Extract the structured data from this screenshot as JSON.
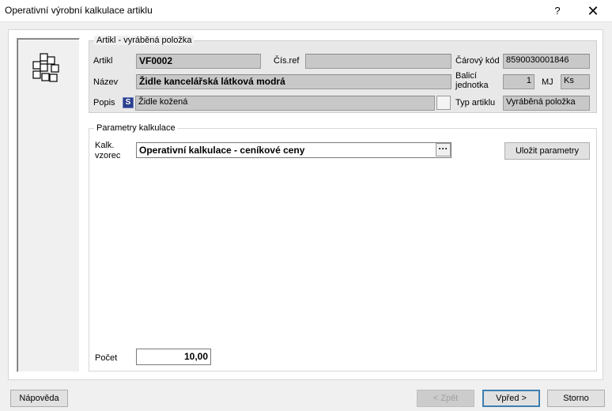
{
  "window": {
    "title": "Operativní výrobní kalkulace artiklu",
    "help_glyph": "?",
    "close_glyph": "✕"
  },
  "artikl_group": {
    "legend": "Artikl - vyráběná položka",
    "artikl_label": "Artikl",
    "artikl_value": "VF0002",
    "cisref_label": "Čís.ref",
    "cisref_value": "",
    "carovy_kod_label": "Čárový kód",
    "carovy_kod_value": "8590030001846",
    "nazev_label": "Název",
    "nazev_value": "Židle kancelářská látková modrá",
    "balici_label_line1": "Balicí",
    "balici_label_line2": "jednotka",
    "balici_value": "1",
    "mj_label": "MJ",
    "mj_value": "Ks",
    "popis_label": "Popis",
    "popis_badge": "S",
    "popis_value": "Židle kožená",
    "typ_label": "Typ artiklu",
    "typ_value": "Vyráběná položka"
  },
  "params_group": {
    "legend": "Parametry kalkulace",
    "vzorec_label_line1": "Kalk.",
    "vzorec_label_line2": "vzorec",
    "vzorec_value": "Operativní kalkulace - ceníkové ceny",
    "vzorec_button": "···",
    "save_button": "Uložit parametry",
    "pocet_label": "Počet",
    "pocet_value": "10,00"
  },
  "footer": {
    "help_button": "Nápověda",
    "back_button": "< Zpět",
    "next_button": "Vpřed >",
    "cancel_button": "Storno"
  },
  "icons": {
    "panel_icon": "stacked-blocks-icon"
  }
}
